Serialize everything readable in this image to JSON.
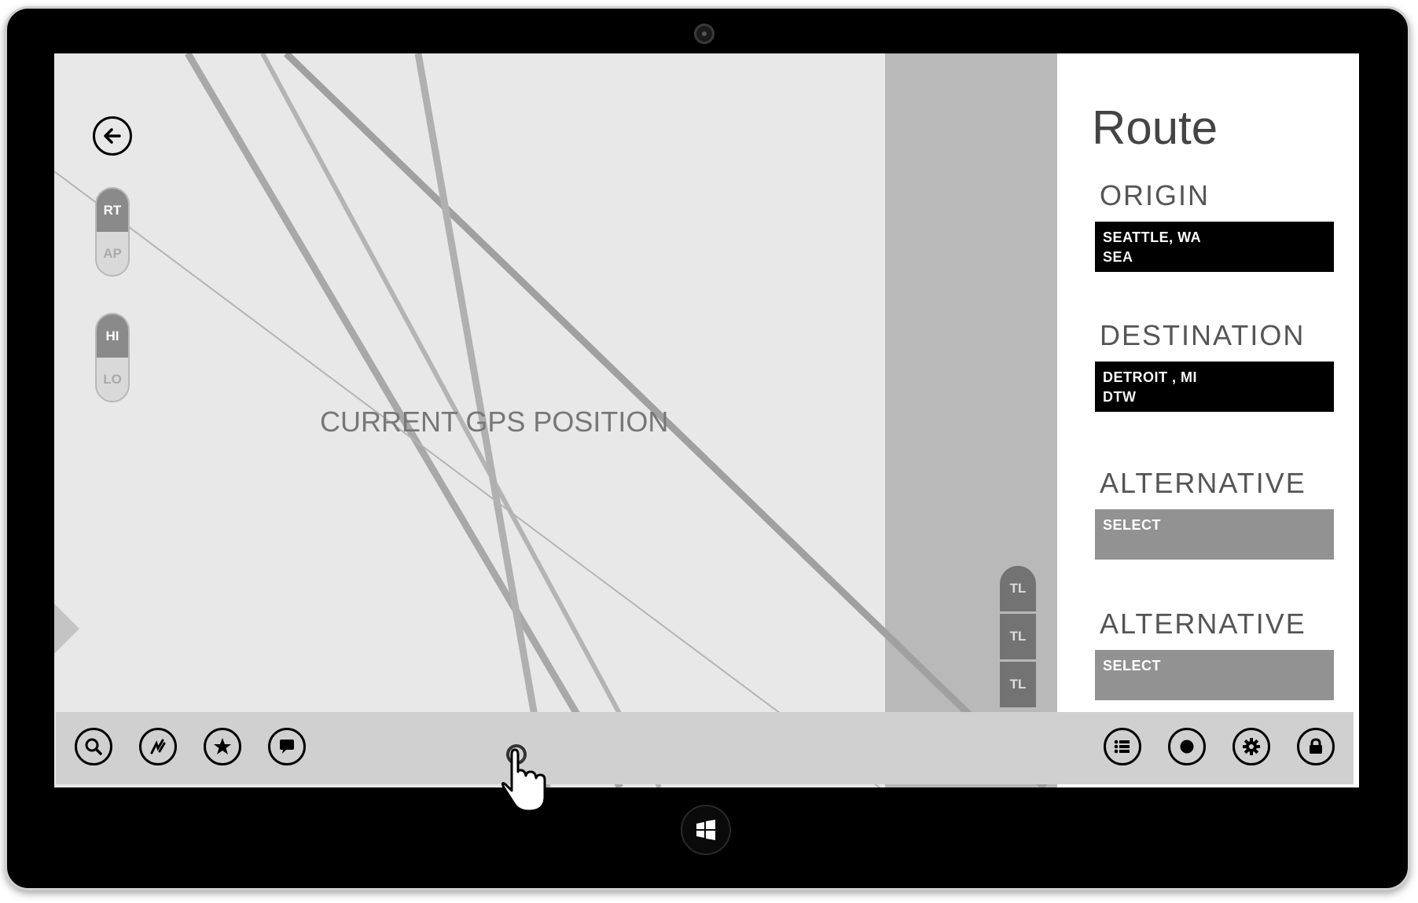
{
  "route_panel": {
    "title": "Route",
    "origin": {
      "label": "ORIGIN",
      "city": "SEATTLE, WA",
      "code": "SEA"
    },
    "destination": {
      "label": "DESTINATION",
      "city": "DETROIT , MI",
      "code": "DTW"
    },
    "alternatives": [
      {
        "label": "ALTERNATIVE",
        "value": "SELECT"
      },
      {
        "label": "ALTERNATIVE",
        "value": "SELECT"
      }
    ]
  },
  "map": {
    "center_label": "CURRENT GPS POSITION"
  },
  "toggles": {
    "mode": {
      "on": "RT",
      "off": "AP"
    },
    "level": {
      "on": "HI",
      "off": "LO"
    }
  },
  "tl_buttons": [
    "TL",
    "TL",
    "TL"
  ],
  "appbar": {
    "left": [
      "search-icon",
      "route-icon",
      "star-icon",
      "chat-icon"
    ],
    "right": [
      "list-icon",
      "record-icon",
      "gear-icon",
      "lock-icon"
    ]
  },
  "colors": {
    "field_selected": "#000000",
    "field_unset": "#929292",
    "map_bg": "#e8e8e8",
    "appbar_bg": "#d0d0d0"
  }
}
